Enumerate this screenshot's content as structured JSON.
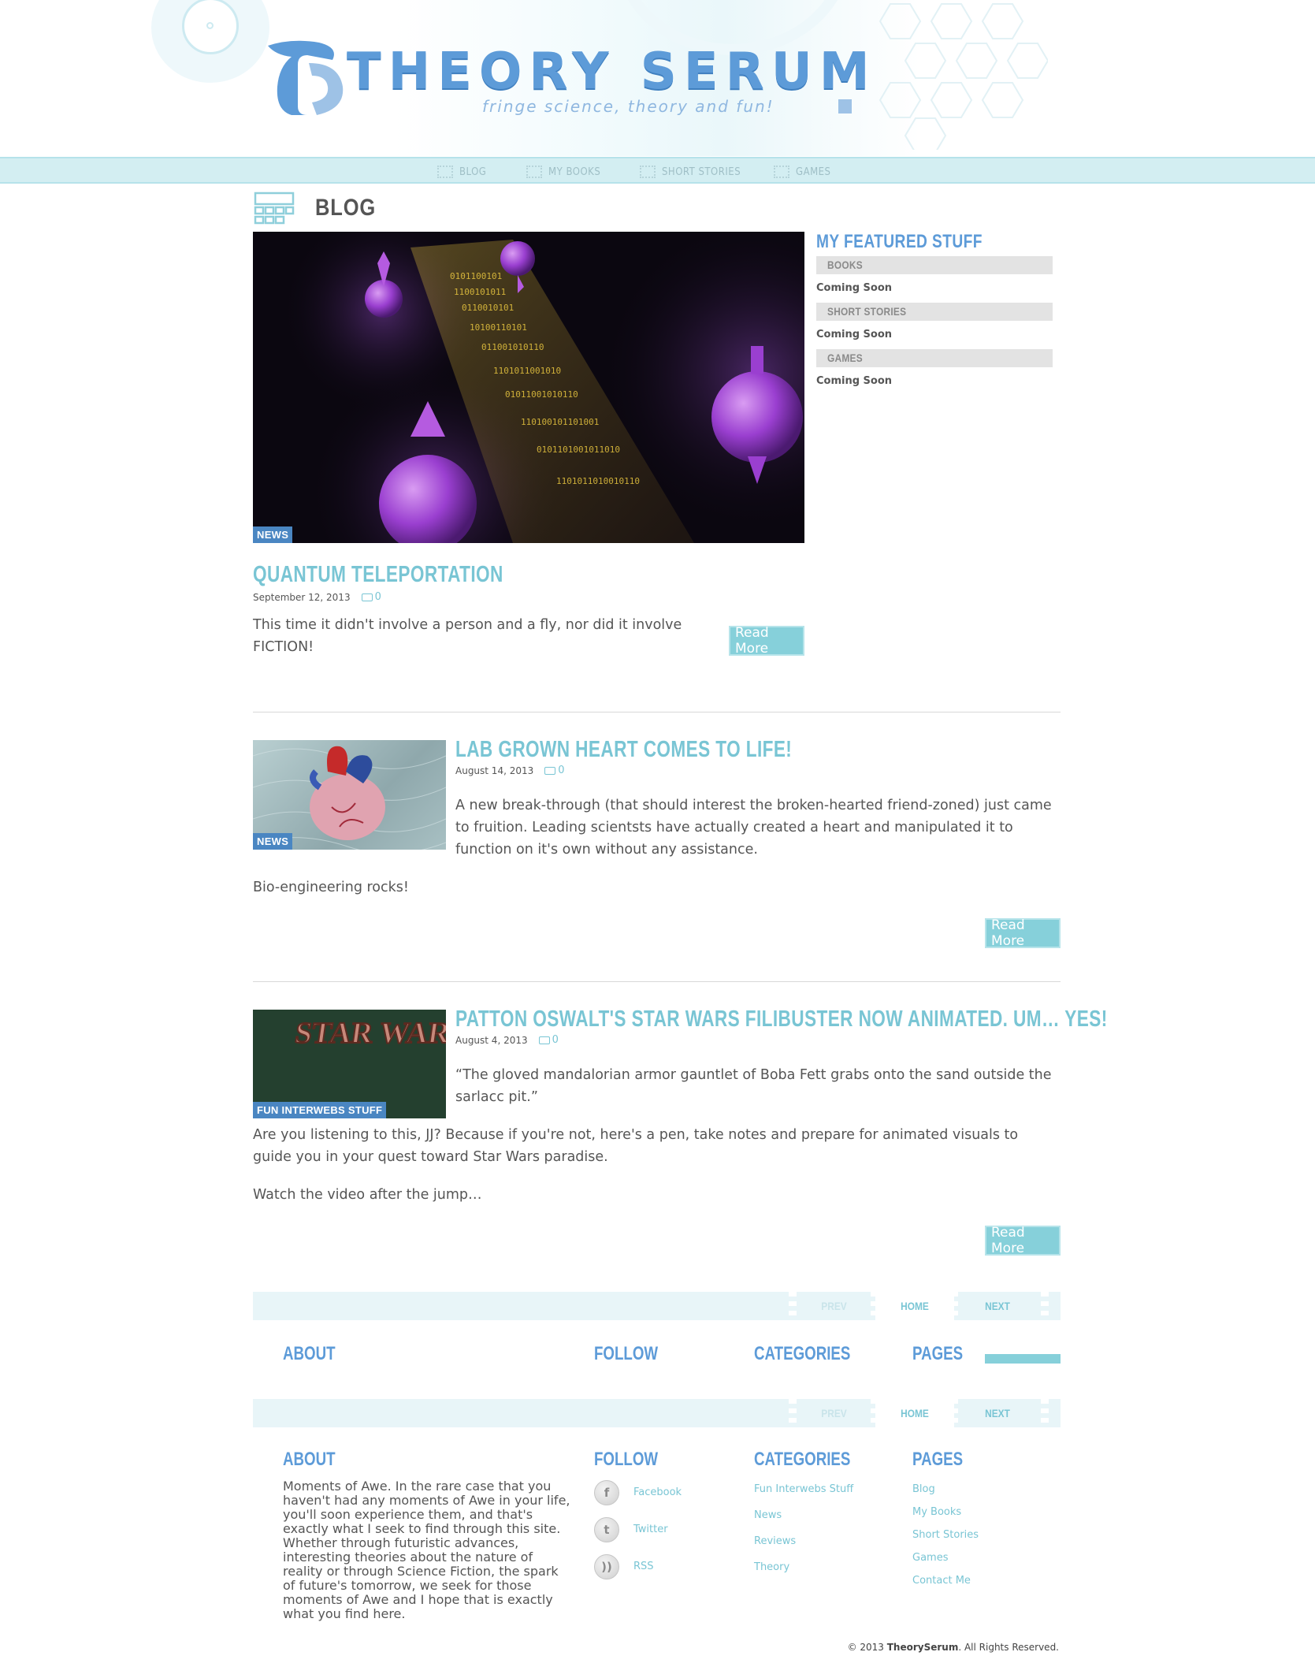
{
  "site": {
    "title": "THEORY SERUM",
    "tagline": "fringe science, theory and fun!"
  },
  "nav": {
    "items": [
      {
        "label": "BLOG",
        "icon": "blog-icon"
      },
      {
        "label": "MY BOOKS",
        "icon": "books-icon"
      },
      {
        "label": "SHORT STORIES",
        "icon": "stories-icon"
      },
      {
        "label": "GAMES",
        "icon": "games-icon"
      }
    ]
  },
  "page": {
    "title": "BLOG"
  },
  "posts": [
    {
      "badge": "NEWS",
      "title": "QUANTUM TELEPORTATION",
      "date": "September 12, 2013",
      "comments": "0",
      "excerpt": "This time it didn't involve a person and a fly, nor did it involve FICTION!",
      "read_more": "Read More"
    },
    {
      "badge": "NEWS",
      "title": "LAB GROWN HEART COMES TO LIFE!",
      "date": "August 14, 2013",
      "comments": "0",
      "excerpt": "A new break-through (that should interest the broken-hearted friend-zoned) just came to fruition. Leading scientsts have actually created a heart and manipulated it to function on it's own without any assistance.",
      "extra": "Bio-engineering rocks!",
      "read_more": "Read More"
    },
    {
      "badge": "FUN INTERWEBS STUFF",
      "thumb_text": "STAR WARS",
      "title": "PATTON OSWALT'S STAR WARS FILIBUSTER NOW ANIMATED. UM… YES!",
      "date": "August 4, 2013",
      "comments": "0",
      "excerpt": "“The gloved mandalorian armor gauntlet of Boba Fett grabs onto the sand outside the sarlacc pit.”",
      "extra": "Are you listening to this, JJ? Because if you're not, here's a pen, take notes and prepare for animated visuals to guide you in your quest toward Star Wars paradise.",
      "extra2": "Watch the video after the jump…",
      "read_more": "Read More"
    }
  ],
  "sidebar": {
    "title": "MY FEATURED STUFF",
    "sections": [
      {
        "heading": "BOOKS",
        "text": "Coming Soon"
      },
      {
        "heading": "SHORT STORIES",
        "text": "Coming Soon"
      },
      {
        "heading": "GAMES",
        "text": "Coming Soon"
      }
    ]
  },
  "pager": {
    "prev": "PREV",
    "home": "HOME",
    "next": "NEXT"
  },
  "footer": {
    "about": {
      "heading": "ABOUT",
      "text": "Moments of Awe. In the rare case that you haven't had any moments of Awe in your life, you'll soon experience them, and that's exactly what I seek to find through this site. Whether through futuristic advances, interesting theories about the nature of reality or through Science Fiction, the spark of future's tomorrow, we seek for those moments of Awe and I hope that is exactly what you find here."
    },
    "follow": {
      "heading": "FOLLOW",
      "items": [
        {
          "label": "Facebook",
          "icon": "facebook-icon",
          "glyph": "f"
        },
        {
          "label": "Twitter",
          "icon": "twitter-icon",
          "glyph": "t"
        },
        {
          "label": "RSS",
          "icon": "rss-icon",
          "glyph": "))"
        }
      ]
    },
    "categories": {
      "heading": "CATEGORIES",
      "items": [
        "Fun Interwebs Stuff",
        "News",
        "Reviews",
        "Theory"
      ]
    },
    "pages": {
      "heading": "PAGES",
      "items": [
        "Blog",
        "My Books",
        "Short Stories",
        "Games",
        "Contact Me"
      ]
    },
    "copyright_prefix": "© 2013 ",
    "copyright_brand": "TheorySerum",
    "copyright_suffix": ". All Rights Reserved."
  },
  "colors": {
    "accent": "#79c5d4",
    "brand_blue": "#5d9bd8",
    "nav_bg": "#d3eef2",
    "badge_bg": "#4a86c2",
    "button_bg": "#86d0da"
  }
}
